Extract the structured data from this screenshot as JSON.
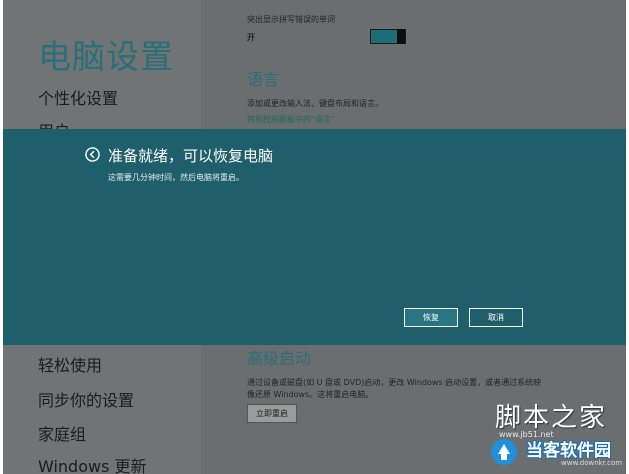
{
  "left_pane": {
    "title": "电脑设置",
    "nav_top": [
      "个性化设置",
      "用户"
    ],
    "nav_bottom": [
      "轻松使用",
      "同步你的设置",
      "家庭组",
      "Windows 更新"
    ]
  },
  "right_pane": {
    "spelling_label": "突出显示拼写错误的单词",
    "spelling_state": "开",
    "language": {
      "heading": "语言",
      "description": "添加或更改输入法、键盘布局和语言。",
      "link": "转到控制面板中的“语言”"
    },
    "advanced": {
      "heading": "高级启动",
      "description_line1": "通过设备或磁盘(如 U 盘或 DVD)启动，更改 Windows 启动设置，或者通过系统映",
      "description_line2": "像还原 Windows。这将重启电脑。",
      "button": "立即重启"
    }
  },
  "dialog": {
    "title": "准备就绪，可以恢复电脑",
    "description": "这需要几分钟时间，然后电脑将重启。",
    "restore_button": "恢复",
    "cancel_button": "取消"
  },
  "watermark": {
    "site_text": "脚本之家",
    "site_url": "www.jb51.net",
    "logo_text": "当客软件园",
    "logo_url": "www.downkr.com"
  },
  "colors": {
    "accent": "#2a6f79",
    "dialog_bg": "#1f5f6c",
    "toggle_on": "#1f6c78"
  }
}
